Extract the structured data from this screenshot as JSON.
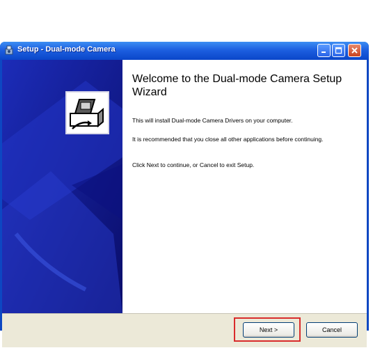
{
  "window": {
    "title": "Setup - Dual-mode Camera",
    "icons": {
      "app": "setup-app-icon",
      "minimize": "minimize-icon",
      "maximize": "maximize-icon",
      "close": "close-icon"
    }
  },
  "wizard": {
    "heading": "Welcome to the Dual-mode Camera Setup Wizard",
    "paragraphs": [
      "This will install Dual-mode Camera Drivers on your computer.",
      "It is recommended that you close all other applications before continuing.",
      "Click Next to continue, or Cancel to exit Setup."
    ],
    "side_icon": "camera-setup-icon"
  },
  "buttons": {
    "next_label": "Next >",
    "cancel_label": "Cancel"
  },
  "colors": {
    "titlebar": "#0a46c9",
    "side_panel": "#10148a",
    "highlight": "#d92b2b",
    "button_bar": "#ece9d8"
  }
}
